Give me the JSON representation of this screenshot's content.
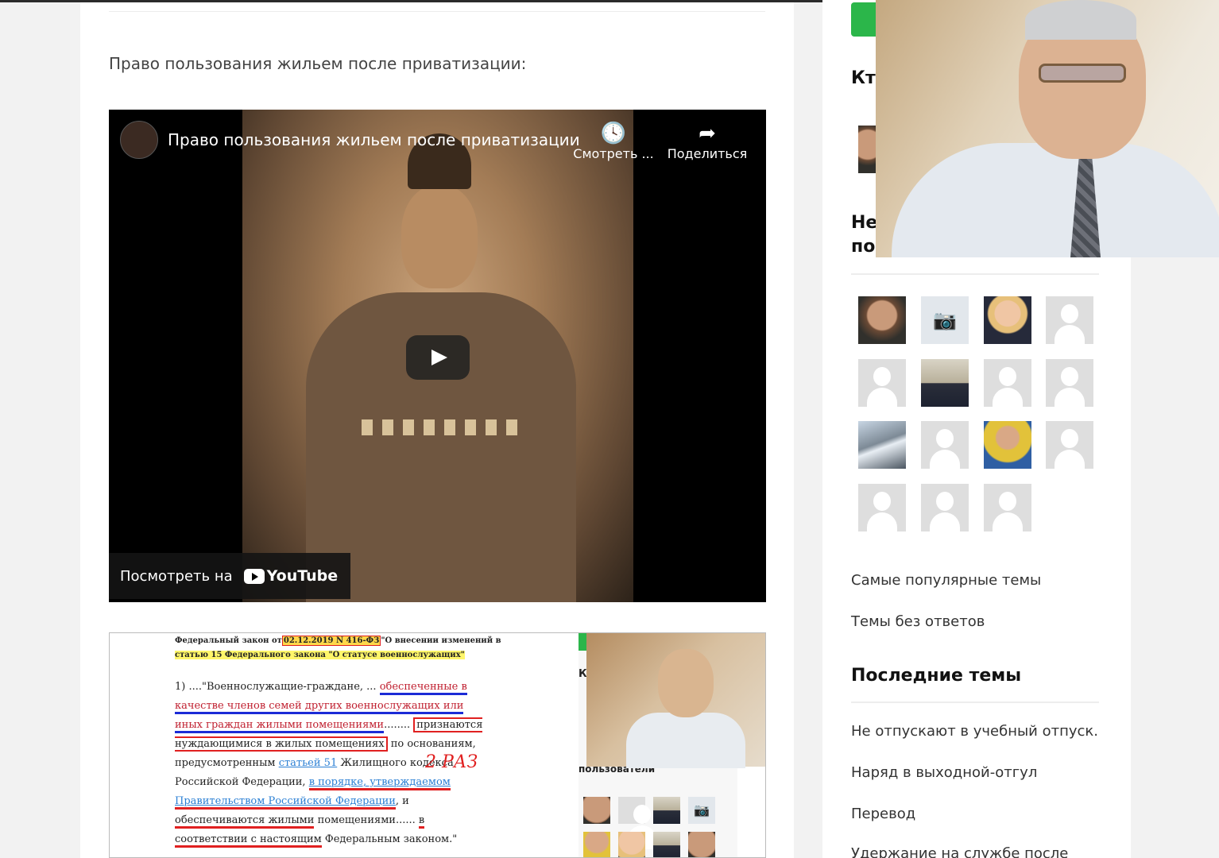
{
  "article": {
    "intro": "Право пользования жильем после приватизации:"
  },
  "video": {
    "title": "Право пользования жильем после приватизации",
    "watch_later_label": "Смотреть ...",
    "share_label": "Поделиться",
    "watch_on_label": "Посмотреть на",
    "youtube_label": "YouTube"
  },
  "embedded_screenshot": {
    "doc_line1_prefix": "Федеральный закон от",
    "doc_line1_date": "02.12.2019 N 416-ФЗ",
    "doc_line1_suffix": "\"О внесении изменений в",
    "doc_line2": "статью 15 Федерального закона \"О статусе военнослужащих\"",
    "doc_p_start": "1) ....\"Военнослужащие-граждане, ... ",
    "doc_p_u1": "обеспеченные в качестве членов семей других военнослужащих или иных граждан жилыми помещениями",
    "doc_p_dots": "........",
    "doc_p_box": "признаются нуждающимися в жилых помещениях",
    "doc_p_grounds": " по основаниям, предусмотренным ",
    "doc_p_link": "статьей 51",
    "doc_p_code": " Жилищного кодекса Российской Федерации, ",
    "doc_p_order": "в порядке, утверждаемом Правительством Российской Федерации",
    "doc_p_and": ", и ",
    "doc_p_provided": "обеспечиваются жилыми",
    "doc_p_rooms": " помещениями...... ",
    "doc_p_accord": "в соответствии с настоящим",
    "doc_p_end": " Федеральным законом.\"",
    "handwritten": "2 РАЗ",
    "mini_k": "К",
    "mini_users": "пользователи"
  },
  "sidebar": {
    "who_heading_partial": "Кто",
    "new_users_heading_line1": "Не",
    "new_users_heading_line2": "по",
    "links": [
      "Самые популярные темы",
      "Темы без ответов"
    ],
    "latest_topics_heading": "Последние темы",
    "latest_topics": [
      "Не отпускают в учебный отпуск.",
      "Наряд в выходной-отгул",
      "Перевод",
      "Удержание на службе после"
    ]
  },
  "icons": {
    "watch_later": "clock-icon",
    "share": "share-arrow-icon",
    "play": "play-icon",
    "camera": "camera-icon"
  },
  "colors": {
    "accent_green": "#2bb64a",
    "youtube_dark": "#000000"
  }
}
